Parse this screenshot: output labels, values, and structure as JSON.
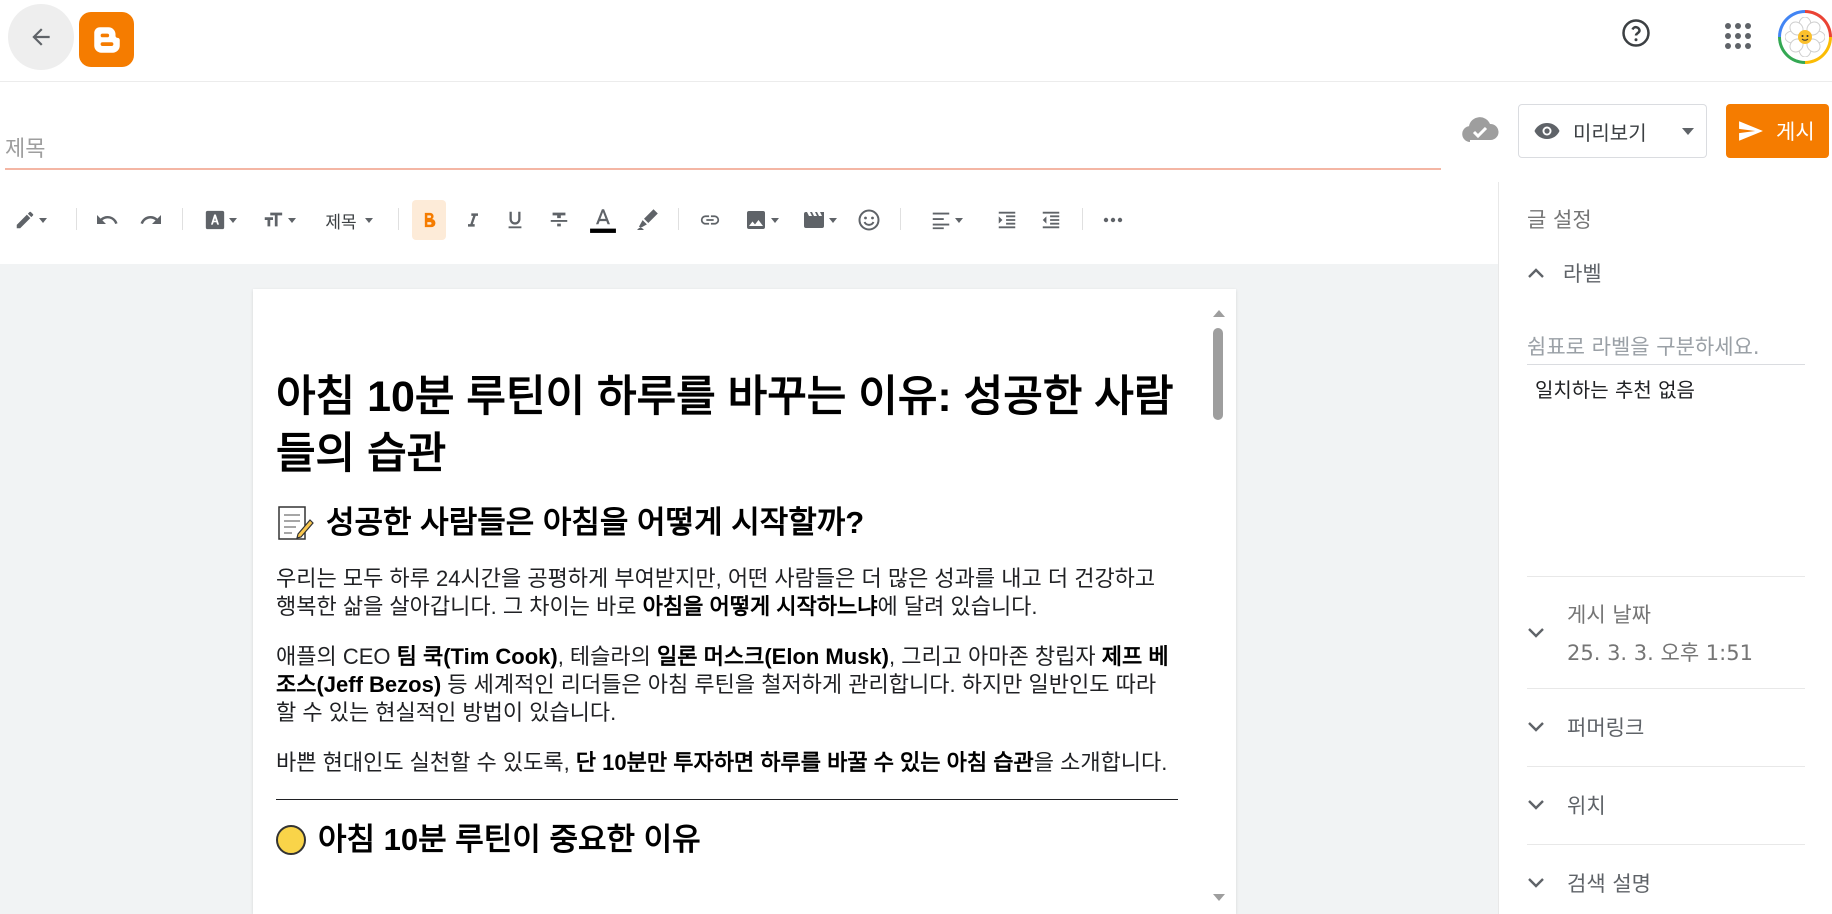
{
  "header": {
    "back_icon": "arrow-left-icon",
    "logo_icon": "blogger-logo",
    "help_icon": "help-circle-icon",
    "apps_icon": "apps-grid-icon",
    "avatar_icon": "flower-avatar"
  },
  "post": {
    "title_placeholder": "제목",
    "title_value": "",
    "preview_label": "미리보기",
    "publish_label": "게시"
  },
  "toolbar": {
    "heading_select": "제목"
  },
  "document": {
    "h1": "아침 10분 루틴이 하루를 바꾸는 이유: 성공한 사람들의 습관",
    "h2_1": "성공한 사람들은 아침을 어떻게 시작할까?",
    "p1_a": "우리는 모두 하루 24시간을 공평하게 부여받지만, 어떤 사람들은 더 많은 성과를 내고 더 건강하고 행복한 삶을 살아갑니다. 그 차이는 바로 ",
    "p1_b": "아침을 어떻게 시작하느냐",
    "p1_c": "에 달려 있습니다.",
    "p2_a": "애플의 CEO ",
    "p2_b": "팀 쿡(Tim Cook)",
    "p2_c": ", 테슬라의 ",
    "p2_d": "일론 머스크(Elon Musk)",
    "p2_e": ", 그리고 아마존 창립자 ",
    "p2_f": "제프 베조스(Jeff Bezos)",
    "p2_g": " 등 세계적인 리더들은 아침 루틴을 철저하게 관리합니다. 하지만 일반인도 따라 할 수 있는 현실적인 방법이 있습니다.",
    "p3_a": "바쁜 현대인도 실천할 수 있도록, ",
    "p3_b": "단 10분만 투자하면 하루를 바꿀 수 있는 아침 습관",
    "p3_c": "을 소개합니다.",
    "h2_2": "아침 10분 루틴이 중요한 이유"
  },
  "sidebar": {
    "heading": "글 설정",
    "labels_title": "라벨",
    "labels_placeholder": "쉼표로 라벨을 구분하세요.",
    "labels_empty": "일치하는 추천 없음",
    "publish_date_title": "게시 날짜",
    "publish_date_value": "25. 3. 3. 오후 1:51",
    "permalink_title": "퍼머링크",
    "location_title": "위치",
    "search_desc_title": "검색 설명"
  },
  "colors": {
    "accent": "#f57c00",
    "title_underline": "#f4b6a4"
  }
}
